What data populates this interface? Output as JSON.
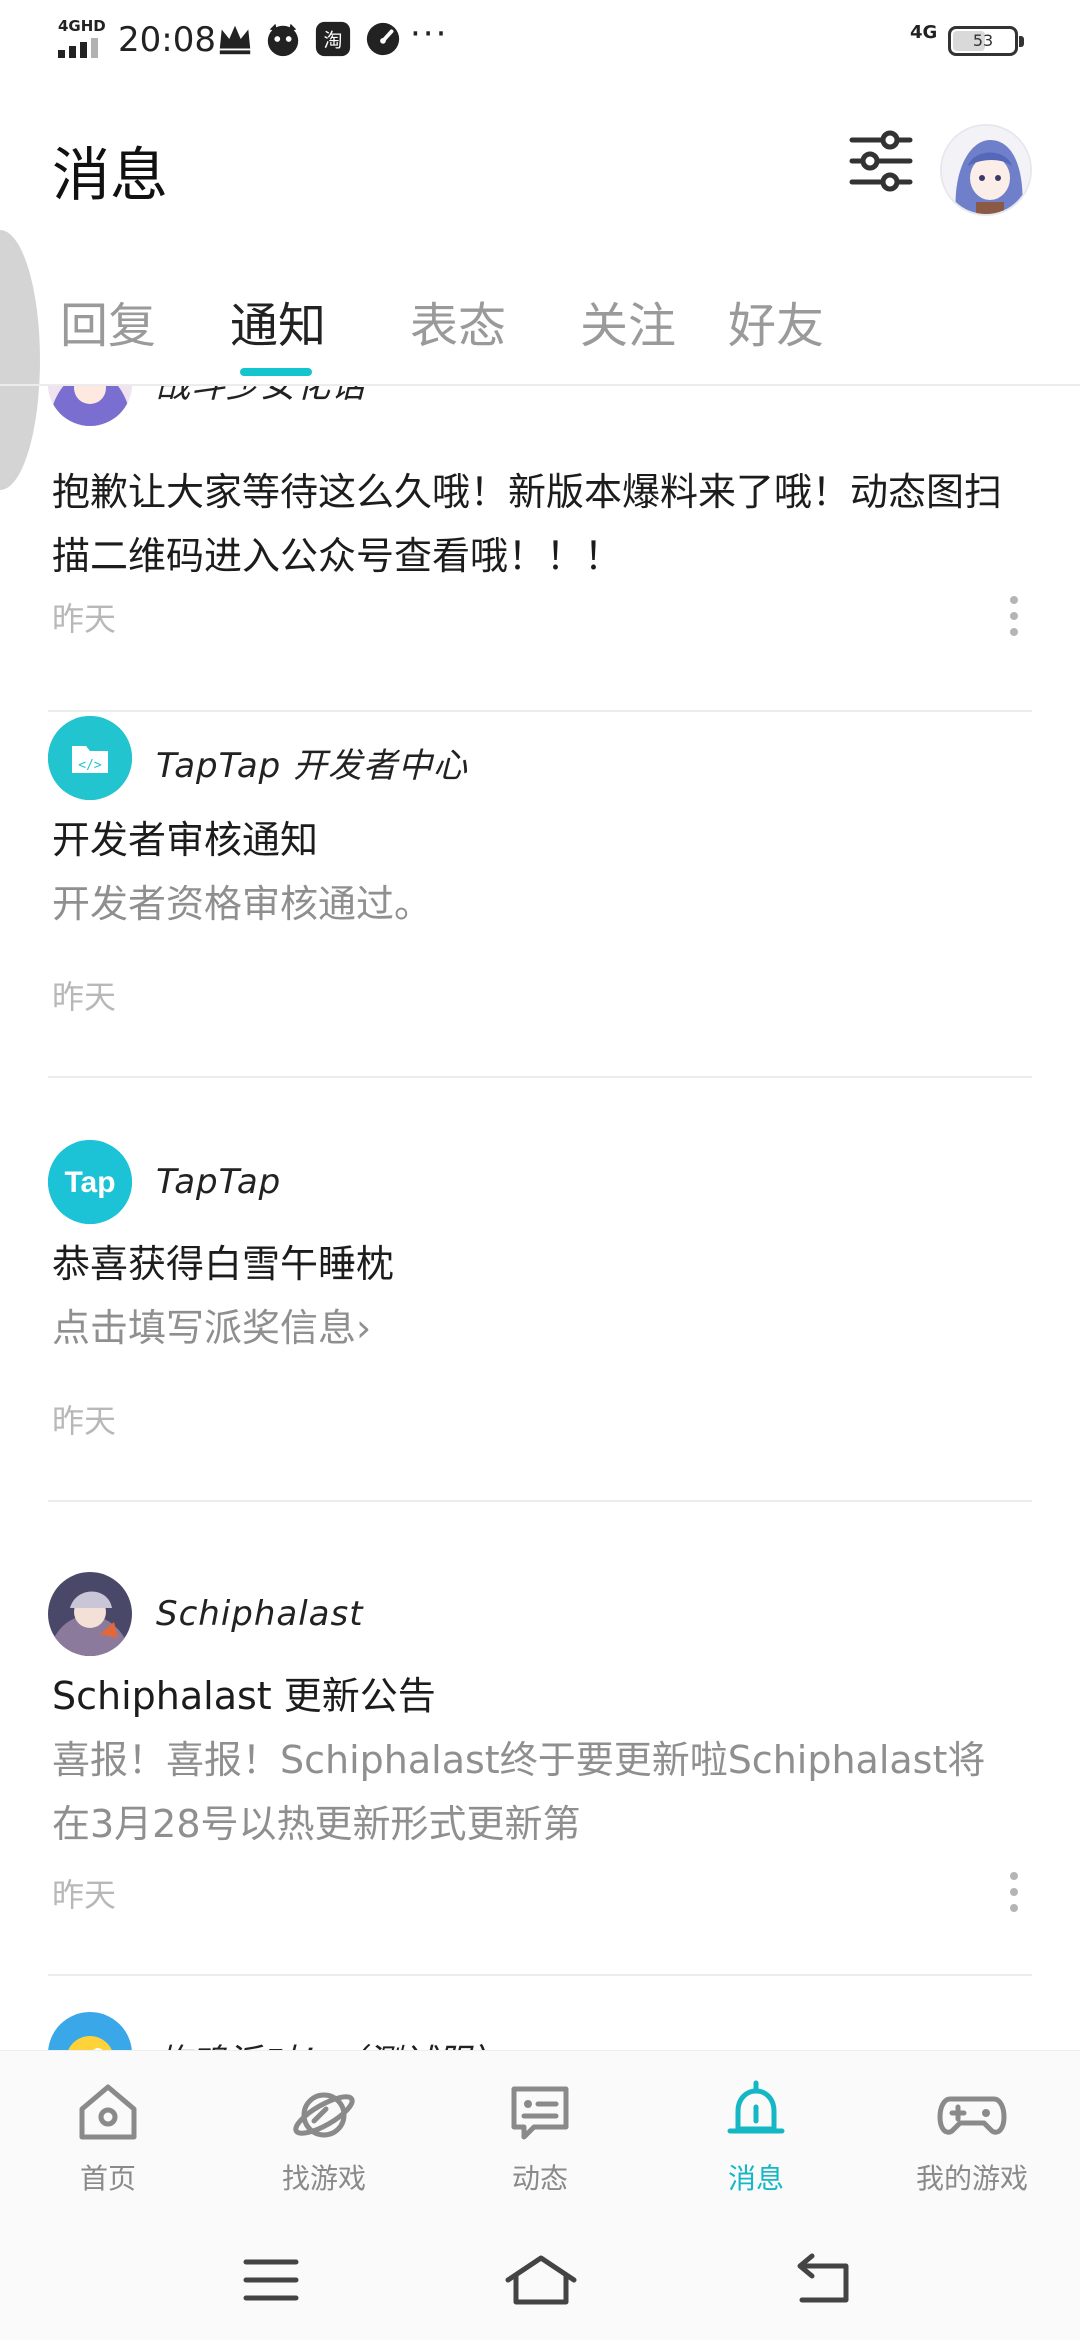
{
  "status_bar": {
    "network": "4GHD",
    "time": "20:08",
    "more": "···",
    "signal_right": "4G",
    "battery": "53",
    "battery_level_percent": 53
  },
  "header": {
    "title": "消息"
  },
  "tabs": [
    {
      "label": "回复",
      "active": false
    },
    {
      "label": "通知",
      "active": true
    },
    {
      "label": "表态",
      "active": false
    },
    {
      "label": "关注",
      "active": false
    },
    {
      "label": "好友",
      "active": false
    }
  ],
  "notifications": [
    {
      "sender": "战斗少女化话",
      "title": "抱歉让大家等待这么久哦！新版本爆料来了哦！动态图扫描二维码进入公众号查看哦！！！",
      "body": "",
      "time": "昨天",
      "has_more": true
    },
    {
      "sender": "TapTap 开发者中心",
      "title": "开发者审核通知",
      "body": "开发者资格审核通过。",
      "time": "昨天",
      "has_more": false
    },
    {
      "sender": "TapTap",
      "avatar_text": "Tap",
      "title": "恭喜获得白雪午睡枕",
      "body": "点击填写派奖信息",
      "body_suffix": "›",
      "time": "昨天",
      "has_more": false
    },
    {
      "sender": "Schiphalast",
      "title": "Schiphalast 更新公告",
      "body": "喜报！喜报！Schiphalast终于要更新啦Schiphalast将在3月28号以热更新形式更新第",
      "time": "昨天",
      "has_more": true
    },
    {
      "sender": "炸鸡派对！（测试服）",
      "title": "",
      "body": "",
      "time": "",
      "has_more": false
    }
  ],
  "bottom_nav": [
    {
      "label": "首页",
      "icon": "home-icon",
      "active": false
    },
    {
      "label": "找游戏",
      "icon": "planet-icon",
      "active": false
    },
    {
      "label": "动态",
      "icon": "chat-card-icon",
      "active": false
    },
    {
      "label": "消息",
      "icon": "bell-icon",
      "active": true
    },
    {
      "label": "我的游戏",
      "icon": "gamepad-icon",
      "active": false
    }
  ],
  "colors": {
    "accent": "#15c5ce",
    "nav_active": "#15b7c4",
    "text_primary": "#1c1c1c",
    "text_secondary": "#8f8f8f",
    "time": "#b8b8b8"
  }
}
